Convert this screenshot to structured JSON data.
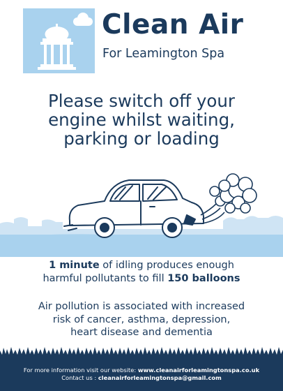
{
  "brand": {
    "title": "Clean Air",
    "subtitle": "For Leamington Spa"
  },
  "headline": {
    "line1": "Please switch off your",
    "line2": "engine whilst waiting,",
    "line3": "parking or loading"
  },
  "facts": {
    "fact1_bold_a": "1 minute",
    "fact1_text_a": " of idling produces enough",
    "fact1_text_b": "harmful pollutants to fill ",
    "fact1_bold_b": "150 balloons",
    "fact2_line1": "Air pollution is associated with increased",
    "fact2_line2": "risk of cancer, asthma, depression,",
    "fact2_line3": "heart disease and dementia"
  },
  "footer": {
    "info_prefix": "For more information visit our website: ",
    "website": "www.cleanairforleamingtonspa.co.uk",
    "contact_prefix": "Contact us : ",
    "email": "cleanairforleamingtonspa@gmail.com"
  },
  "colors": {
    "navy": "#1b3a5c",
    "sky_blue": "#a9d2ee",
    "light_blue": "#cfe4f4",
    "white": "#ffffff"
  },
  "icons": [
    "pavilion-icon",
    "cloud-icon",
    "car-illustration",
    "exhaust-smoke-icon",
    "grass-silhouette"
  ]
}
